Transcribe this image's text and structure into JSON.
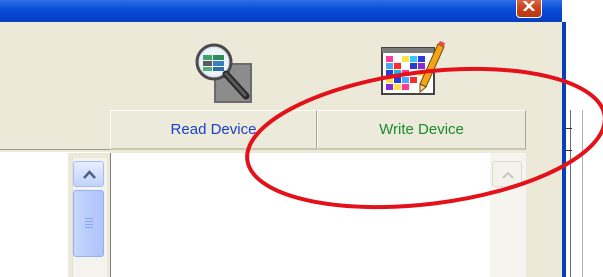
{
  "window": {
    "close_icon": "close-icon"
  },
  "toolbar": {
    "read_icon": "magnifier-table-icon",
    "write_icon": "palette-pencil-icon"
  },
  "columns": [
    {
      "label": "Read Device",
      "color": "#1f3ec4"
    },
    {
      "label": "Write Device",
      "color": "#1b8a2a"
    }
  ],
  "scrollbars": {
    "left": {
      "arrow": "chevron-up-icon",
      "state": "enabled"
    },
    "right": {
      "arrow": "chevron-up-icon",
      "state": "disabled"
    }
  },
  "annotation": {
    "shape": "ellipse",
    "color": "#e3121a",
    "target": "Write Device"
  }
}
